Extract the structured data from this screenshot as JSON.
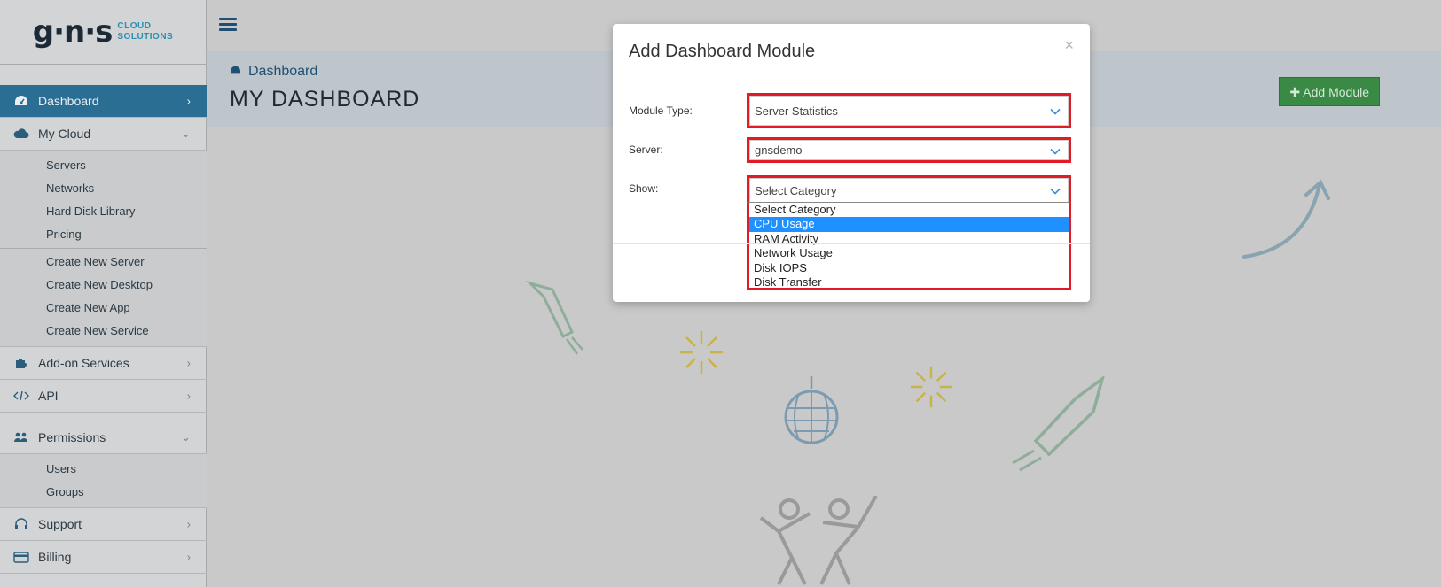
{
  "brand": {
    "mark": "g·n·s",
    "line1": "CLOUD",
    "line2": "SOLUTIONS"
  },
  "sidebar": {
    "items": [
      {
        "label": "Dashboard",
        "icon": "dashboard-icon",
        "active": true
      },
      {
        "label": "My Cloud",
        "icon": "cloud-icon",
        "expanded": true,
        "children": [
          "Servers",
          "Networks",
          "Hard Disk Library",
          "Pricing"
        ],
        "children2": [
          "Create New Server",
          "Create New Desktop",
          "Create New App",
          "Create New Service"
        ]
      },
      {
        "label": "Add-on Services",
        "icon": "puzzle-icon"
      },
      {
        "label": "API",
        "icon": "code-icon"
      },
      {
        "label": "Permissions",
        "icon": "users-icon",
        "expanded": true,
        "children": [
          "Users",
          "Groups"
        ]
      },
      {
        "label": "Support",
        "icon": "headset-icon"
      },
      {
        "label": "Billing",
        "icon": "credit-card-icon"
      }
    ]
  },
  "header": {
    "breadcrumb": "Dashboard",
    "title": "MY DASHBOARD",
    "add_module_label": "Add Module"
  },
  "modal": {
    "title": "Add Dashboard Module",
    "close_glyph": "×",
    "fields": {
      "module_type": {
        "label": "Module Type:",
        "value": "Server Statistics"
      },
      "server": {
        "label": "Server:",
        "value": "gnsdemo"
      },
      "show": {
        "label": "Show:",
        "value": "Select Category"
      }
    },
    "show_options": [
      "Select Category",
      "CPU Usage",
      "RAM Activity",
      "Network Usage",
      "Disk IOPS",
      "Disk Transfer"
    ],
    "show_highlighted": "CPU Usage"
  },
  "colors": {
    "active_nav": "#2a6e94",
    "add_button": "#3a8a46",
    "highlight_border": "#e01b24",
    "option_selected": "#1e90ff"
  }
}
